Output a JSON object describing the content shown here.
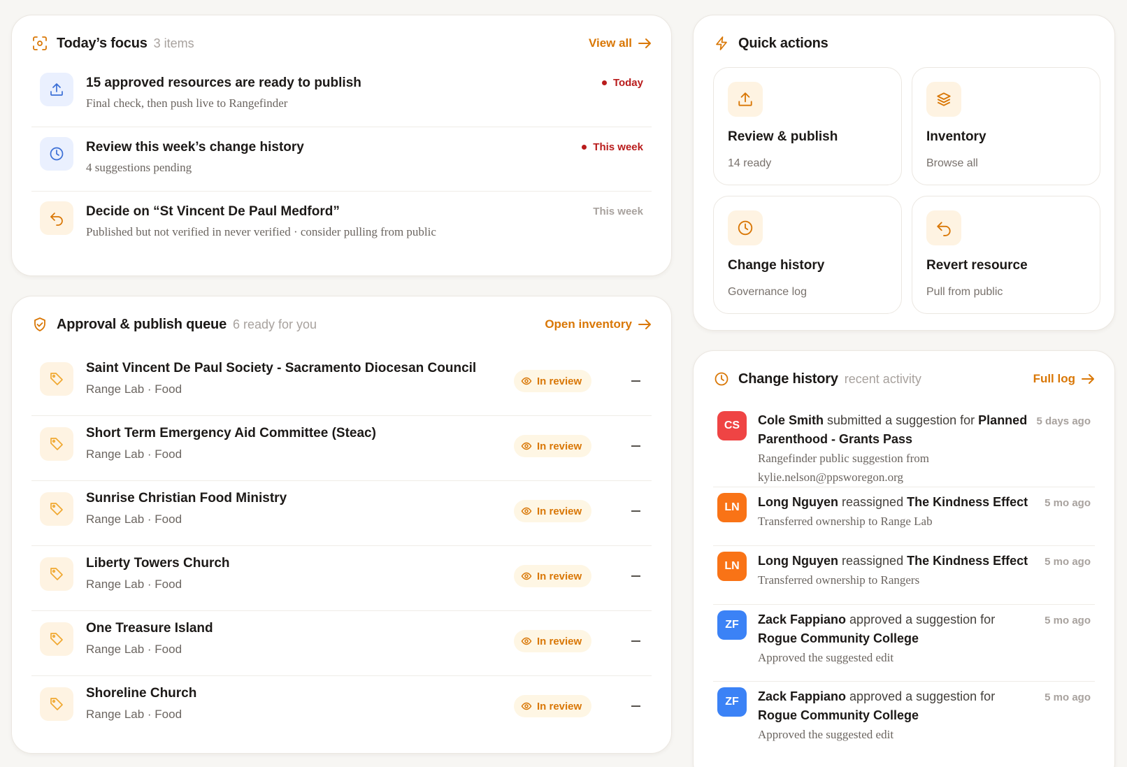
{
  "colors": {
    "accent": "#d97706",
    "danger": "#b91c1c",
    "avatar_red": "#ef4444",
    "avatar_orange": "#f97316",
    "avatar_blue": "#3b82f6"
  },
  "focus": {
    "title": "Today’s focus",
    "subtitle": "3 items",
    "link": "View all",
    "items": [
      {
        "title": "15 approved resources are ready to publish",
        "subtitle": "Final check, then push live to Rangefinder",
        "badge": "Today",
        "icon": "upload-icon"
      },
      {
        "title": "Review this week’s change history",
        "subtitle": "4 suggestions pending",
        "badge": "This week",
        "icon": "clock-icon"
      },
      {
        "title": "Decide on “St Vincent De Paul Medford”",
        "subtitle": "Published but not verified in never verified · consider pulling from public",
        "badge": "This week",
        "icon": "undo-icon"
      }
    ]
  },
  "queue": {
    "title": "Approval & publish queue",
    "subtitle": "6 ready for you",
    "link": "Open inventory",
    "items": [
      {
        "title": "Saint Vincent De Paul Society - Sacramento Diocesan Council",
        "meta": "Range Lab · Food",
        "status": "In review"
      },
      {
        "title": "Short Term Emergency Aid Committee (Steac)",
        "meta": "Range Lab · Food",
        "status": "In review"
      },
      {
        "title": "Sunrise Christian Food Ministry",
        "meta": "Range Lab · Food",
        "status": "In review"
      },
      {
        "title": "Liberty Towers Church",
        "meta": "Range Lab · Food",
        "status": "In review"
      },
      {
        "title": "One Treasure Island",
        "meta": "Range Lab · Food",
        "status": "In review"
      },
      {
        "title": "Shoreline Church",
        "meta": "Range Lab · Food",
        "status": "In review"
      }
    ]
  },
  "quick": {
    "title": "Quick actions",
    "tiles": [
      {
        "title": "Review & publish",
        "sub": "14 ready",
        "icon": "upload-icon"
      },
      {
        "title": "Inventory",
        "sub": "Browse all",
        "icon": "layers-icon"
      },
      {
        "title": "Change history",
        "sub": "Governance log",
        "icon": "clock-icon"
      },
      {
        "title": "Revert resource",
        "sub": "Pull from public",
        "icon": "undo-icon"
      }
    ]
  },
  "history": {
    "title": "Change history",
    "subtitle": "recent activity",
    "link": "Full log",
    "items": [
      {
        "initials": "CS",
        "actor": "Cole Smith",
        "verb": "submitted a suggestion for",
        "target": "Planned Parenthood - Grants Pass",
        "desc": "Rangefinder public suggestion from kylie.nelson@ppsworegon.org",
        "time": "5 days ago"
      },
      {
        "initials": "LN",
        "actor": "Long Nguyen",
        "verb": "reassigned",
        "target": "The Kindness Effect",
        "desc": "Transferred ownership to Range Lab",
        "time": "5 mo ago"
      },
      {
        "initials": "LN",
        "actor": "Long Nguyen",
        "verb": "reassigned",
        "target": "The Kindness Effect",
        "desc": "Transferred ownership to Rangers",
        "time": "5 mo ago"
      },
      {
        "initials": "ZF",
        "actor": "Zack Fappiano",
        "verb": "approved a suggestion for",
        "target": "Rogue Community College",
        "desc": "Approved the suggested edit",
        "time": "5 mo ago"
      },
      {
        "initials": "ZF",
        "actor": "Zack Fappiano",
        "verb": "approved a suggestion for",
        "target": "Rogue Community College",
        "desc": "Approved the suggested edit",
        "time": "5 mo ago"
      }
    ]
  }
}
